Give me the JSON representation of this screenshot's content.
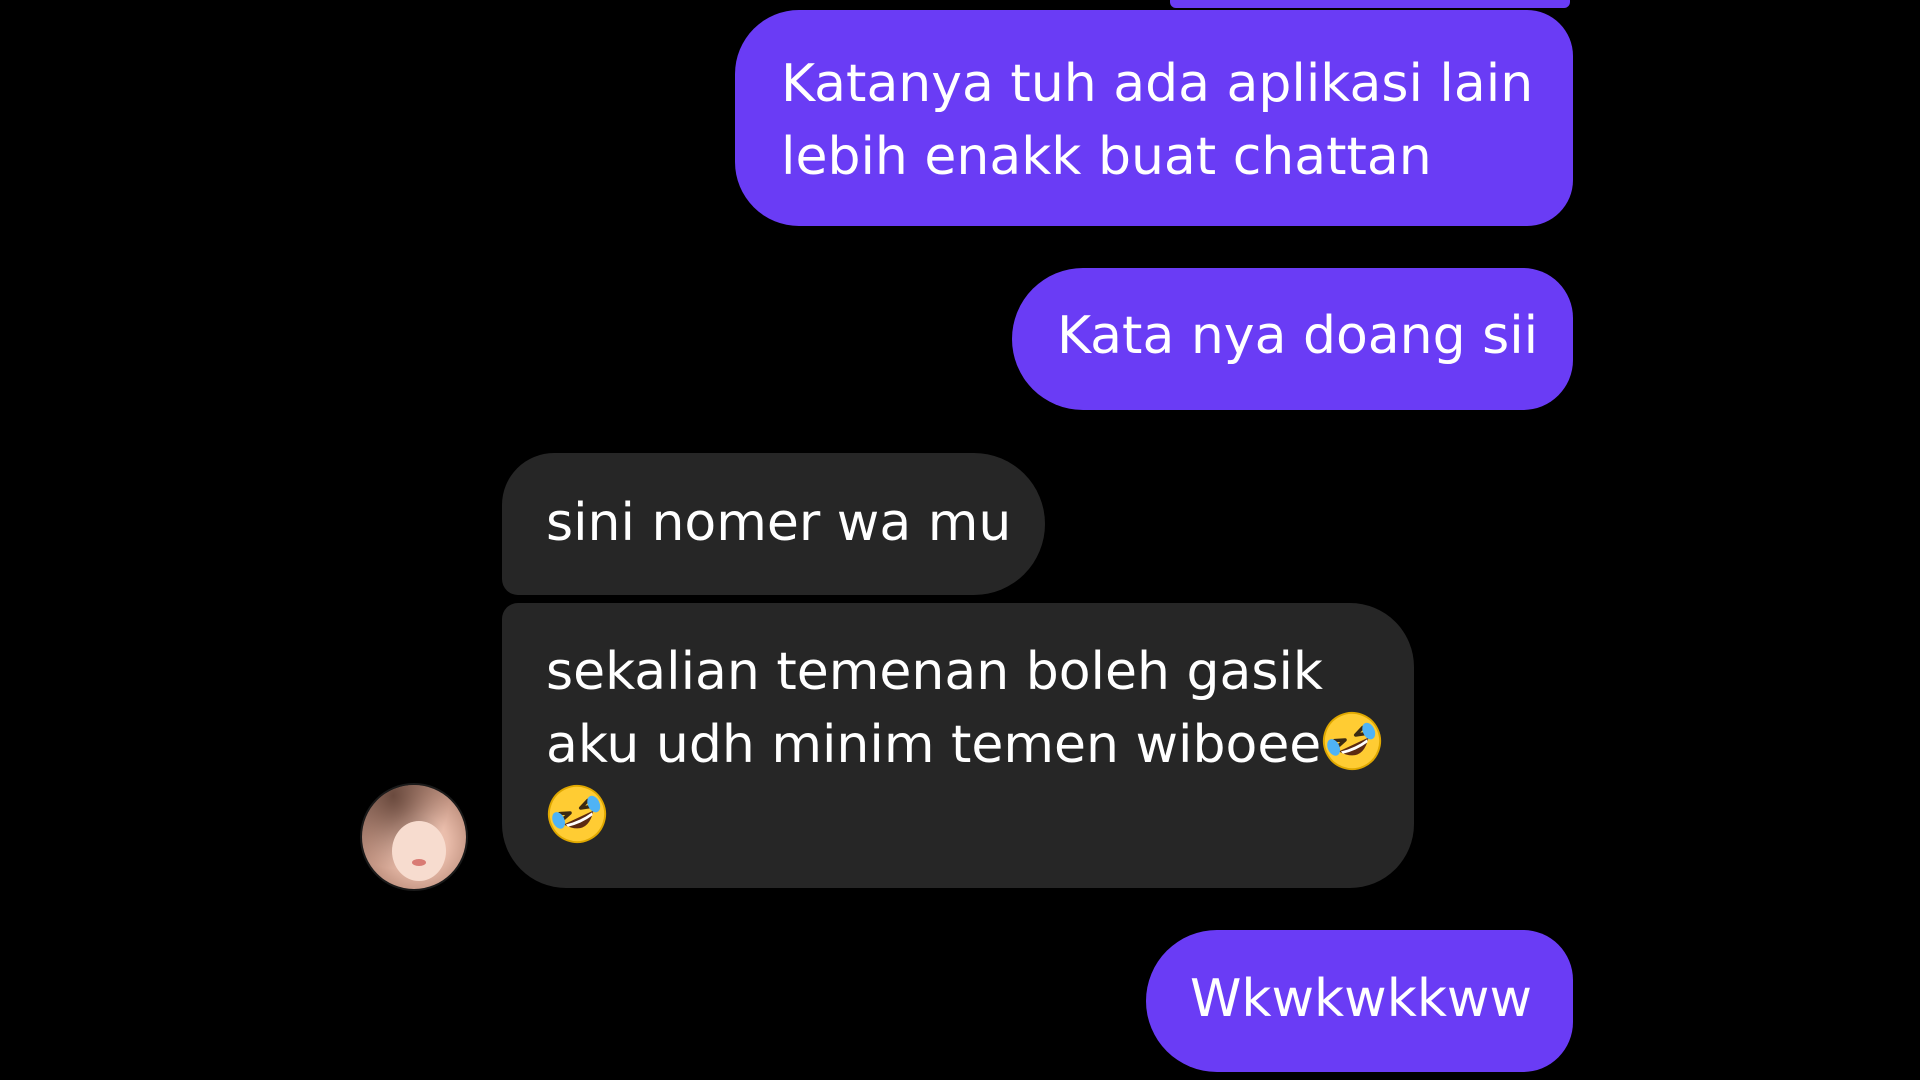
{
  "conversation": {
    "messages": [
      {
        "direction": "sent",
        "lines": [
          "Katanya tuh ada aplikasi lain",
          "lebih enakk buat chattan"
        ]
      },
      {
        "direction": "sent",
        "lines": [
          "Kata nya doang sii"
        ]
      },
      {
        "direction": "received",
        "lines": [
          "sini nomer wa mu"
        ]
      },
      {
        "direction": "received",
        "lines": [
          "sekalian temenan boleh gasik",
          "aku udh minim temen wiboee"
        ],
        "emoji": "rolling-on-floor-laughing-emoji"
      },
      {
        "direction": "sent",
        "lines": [
          "Wkwkwkkww"
        ]
      }
    ]
  },
  "contact": {
    "avatar_icon": "contact-avatar"
  },
  "colors": {
    "background": "#000000",
    "sent_bubble": "#6a3cf5",
    "received_bubble": "#262626",
    "text": "#ffffff"
  }
}
